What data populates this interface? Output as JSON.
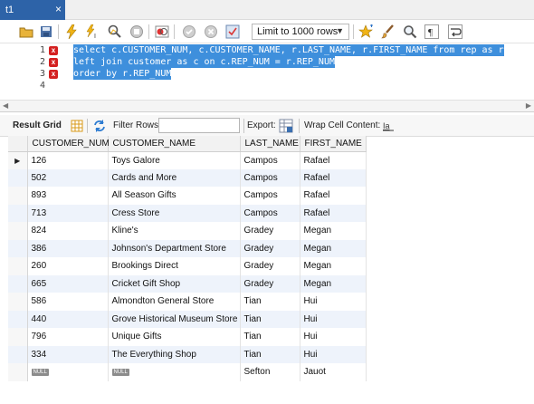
{
  "tab": {
    "title": "t1",
    "close": "×"
  },
  "toolbar": {
    "limit_select": "Limit to 1000 rows"
  },
  "editor": {
    "lines": [
      {
        "num": "1",
        "has_error": true,
        "text": "select c.CUSTOMER_NUM, c.CUSTOMER_NAME, r.LAST_NAME, r.FIRST_NAME from rep as r"
      },
      {
        "num": "2",
        "has_error": true,
        "text": "left join customer as c on c.REP_NUM = r.REP_NUM"
      },
      {
        "num": "3",
        "has_error": true,
        "text": "order by r.REP_NUM"
      },
      {
        "num": "4",
        "has_error": false,
        "text": ""
      }
    ],
    "error_glyph": "x"
  },
  "result_toolbar": {
    "result_grid": "Result Grid",
    "filter_rows": "Filter Rows:",
    "filter_value": "",
    "export": "Export:",
    "wrap_cell": "Wrap Cell Content:"
  },
  "grid": {
    "columns": [
      "CUSTOMER_NUM",
      "CUSTOMER_NAME",
      "LAST_NAME",
      "FIRST_NAME"
    ],
    "current_row_marker": "▶",
    "null_label": "NULL",
    "rows": [
      [
        "126",
        "Toys Galore",
        "Campos",
        "Rafael"
      ],
      [
        "502",
        "Cards and More",
        "Campos",
        "Rafael"
      ],
      [
        "893",
        "All Season Gifts",
        "Campos",
        "Rafael"
      ],
      [
        "713",
        "Cress Store",
        "Campos",
        "Rafael"
      ],
      [
        "824",
        "Kline's",
        "Gradey",
        "Megan"
      ],
      [
        "386",
        "Johnson's Department Store",
        "Gradey",
        "Megan"
      ],
      [
        "260",
        "Brookings Direct",
        "Gradey",
        "Megan"
      ],
      [
        "665",
        "Cricket Gift Shop",
        "Gradey",
        "Megan"
      ],
      [
        "586",
        "Almondton General Store",
        "Tian",
        "Hui"
      ],
      [
        "440",
        "Grove Historical Museum Store",
        "Tian",
        "Hui"
      ],
      [
        "796",
        "Unique Gifts",
        "Tian",
        "Hui"
      ],
      [
        "334",
        "The Everything Shop",
        "Tian",
        "Hui"
      ],
      [
        null,
        null,
        "Sefton",
        "Jauot"
      ]
    ]
  },
  "colors": {
    "tab_active": "#2d63a8",
    "selection": "#3e8fdc",
    "alt_row": "#eef3fb",
    "error_marker": "#d42020"
  }
}
